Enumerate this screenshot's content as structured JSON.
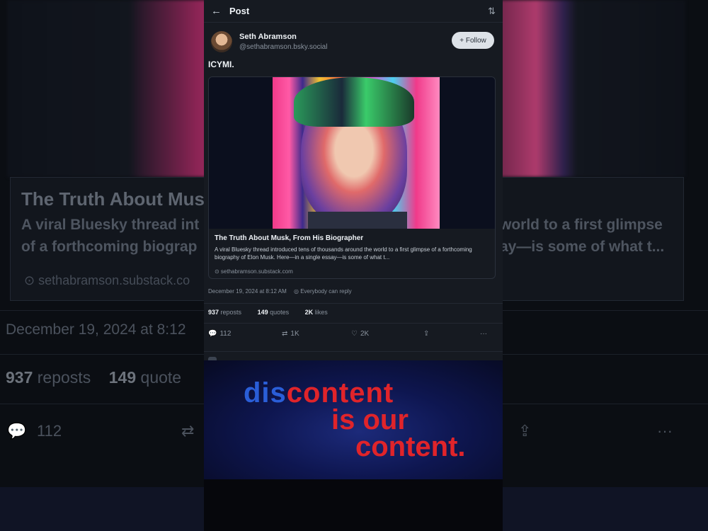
{
  "background": {
    "link_title": "The Truth About Mus",
    "desc_line1": "A viral Bluesky thread int",
    "desc_line2": "of a forthcoming biograp",
    "desc_right1": "world to a first glimpse",
    "desc_right2": "ay—is some of what t...",
    "source": "⊙ sethabramson.substack.co",
    "date": "December 19, 2024 at 8:12",
    "reposts_count": "937",
    "reposts_label": "reposts",
    "quotes_count": "149",
    "quotes_label": "quote",
    "reply_count": "112"
  },
  "topbar": {
    "back_glyph": "←",
    "title": "Post",
    "sort_glyph": "⇅"
  },
  "author": {
    "name": "Seth Abramson",
    "handle": "@sethabramson.bsky.social",
    "follow_label": "+ Follow"
  },
  "post": {
    "text": "ICYMI."
  },
  "link_card": {
    "title": "The Truth About Musk, From His Biographer",
    "description": "A viral Bluesky thread introduced tens of thousands around the world to a first glimpse of a forthcoming biography of Elon Musk. Here—in a single essay—is some of what t...",
    "domain": "⊙ sethabramson.substack.com"
  },
  "meta": {
    "timestamp": "December 19, 2024 at 8:12 AM",
    "audience": "Everybody can reply",
    "globe_glyph": "◎"
  },
  "stats": {
    "reposts_count": "937",
    "reposts_label": "reposts",
    "quotes_count": "149",
    "quotes_label": "quotes",
    "likes_count": "2K",
    "likes_label": "likes"
  },
  "actions": {
    "reply_glyph": "💬",
    "reply_count": "112",
    "repost_glyph": "⇄",
    "repost_count": "1K",
    "like_glyph": "♡",
    "like_count": "2K",
    "share_glyph": "⇪",
    "more_glyph": "···"
  },
  "overlay": {
    "dis": "dis",
    "content1": "content",
    "line2": "is our",
    "line3": "content."
  },
  "colors": {
    "accent_blue": "#2a5ed8",
    "accent_red": "#e0242a",
    "panel_bg": "#161a21"
  }
}
